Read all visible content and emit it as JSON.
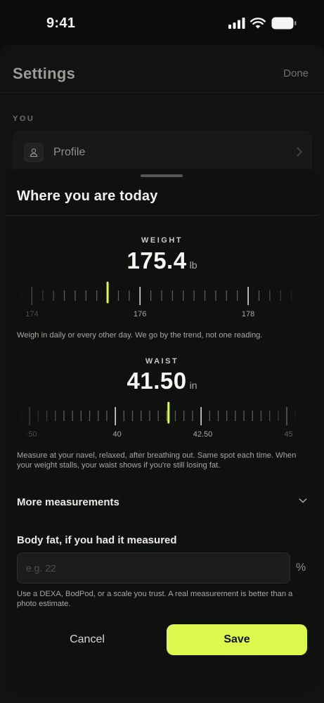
{
  "status_bar": {
    "time": "9:41"
  },
  "settings": {
    "title": "Settings",
    "done_label": "Done",
    "section_you": "YOU",
    "profile_label": "Profile"
  },
  "sheet": {
    "title": "Where you are today",
    "weight": {
      "label": "WEIGHT",
      "value": "175.4",
      "unit": "lb",
      "ruler": {
        "min": 173.8,
        "max": 179.0,
        "step": 0.2,
        "current": 175.4,
        "labels": [
          "174",
          "176",
          "178"
        ],
        "label_values": [
          174,
          176,
          178
        ]
      },
      "hint": "Weigh in daily or every other day. We go by the trend, not one reading."
    },
    "waist": {
      "label": "WAIST",
      "value": "41.50",
      "unit": "in",
      "ruler": {
        "min": 37.2,
        "max": 45.4,
        "step": 0.25,
        "current": 41.5,
        "labels": [
          "·50",
          "40",
          "42.50",
          "45"
        ],
        "label_values": [
          37.5,
          40,
          42.5,
          45
        ]
      },
      "hint": "Measure at your navel, relaxed, after breathing out. Same spot each time. When your weight stalls, your waist shows if you're still losing fat."
    },
    "more_measurements": "More measurements",
    "body_fat": {
      "label": "Body fat, if you had it measured",
      "placeholder": "e.g. 22",
      "unit": "%",
      "hint": "Use a DEXA, BodPod, or a scale you trust. A real measurement is better than a photo estimate."
    },
    "cancel_label": "Cancel",
    "save_label": "Save"
  },
  "colors": {
    "accent": "#dcf94d",
    "background": "#0b0c0b",
    "sheet": "#0f110f"
  }
}
